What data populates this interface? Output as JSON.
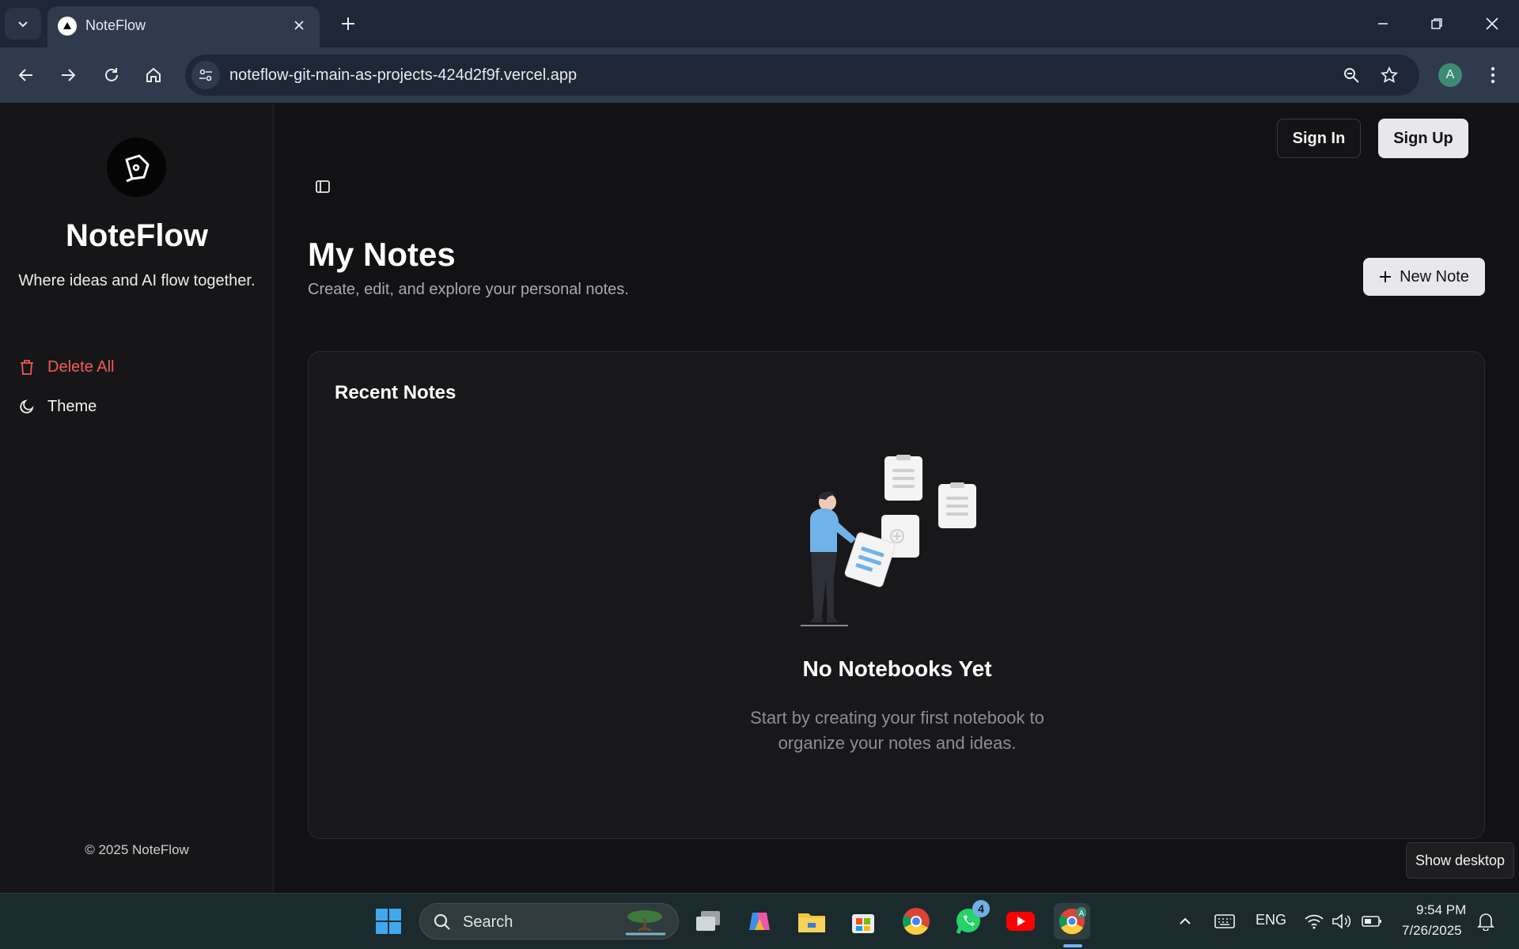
{
  "browser": {
    "tab_title": "NoteFlow",
    "url": "noteflow-git-main-as-projects-424d2f9f.vercel.app",
    "profile_initial": "A"
  },
  "sidebar": {
    "brand": "NoteFlow",
    "tagline": "Where ideas and AI flow together.",
    "items": [
      {
        "label": "Delete All",
        "icon": "trash-icon"
      },
      {
        "label": "Theme",
        "icon": "moon-icon"
      }
    ],
    "copyright": "© 2025 NoteFlow"
  },
  "header": {
    "sign_in": "Sign In",
    "sign_up": "Sign Up"
  },
  "main": {
    "title": "My Notes",
    "subtitle": "Create, edit, and explore your personal notes.",
    "new_note": "New Note",
    "recent_notes_title": "Recent Notes",
    "empty_title": "No Notebooks Yet",
    "empty_desc": "Start by creating your first notebook to organize your notes and ideas."
  },
  "tooltip": "Show desktop",
  "taskbar": {
    "search": "Search",
    "whatsapp_badge": "4",
    "language": "ENG",
    "time": "9:54 PM",
    "date": "7/26/2025"
  },
  "colors": {
    "danger": "#ef5a5a",
    "background": "#121214",
    "card": "#18181b",
    "illustration_accent": "#6fb3e8"
  }
}
